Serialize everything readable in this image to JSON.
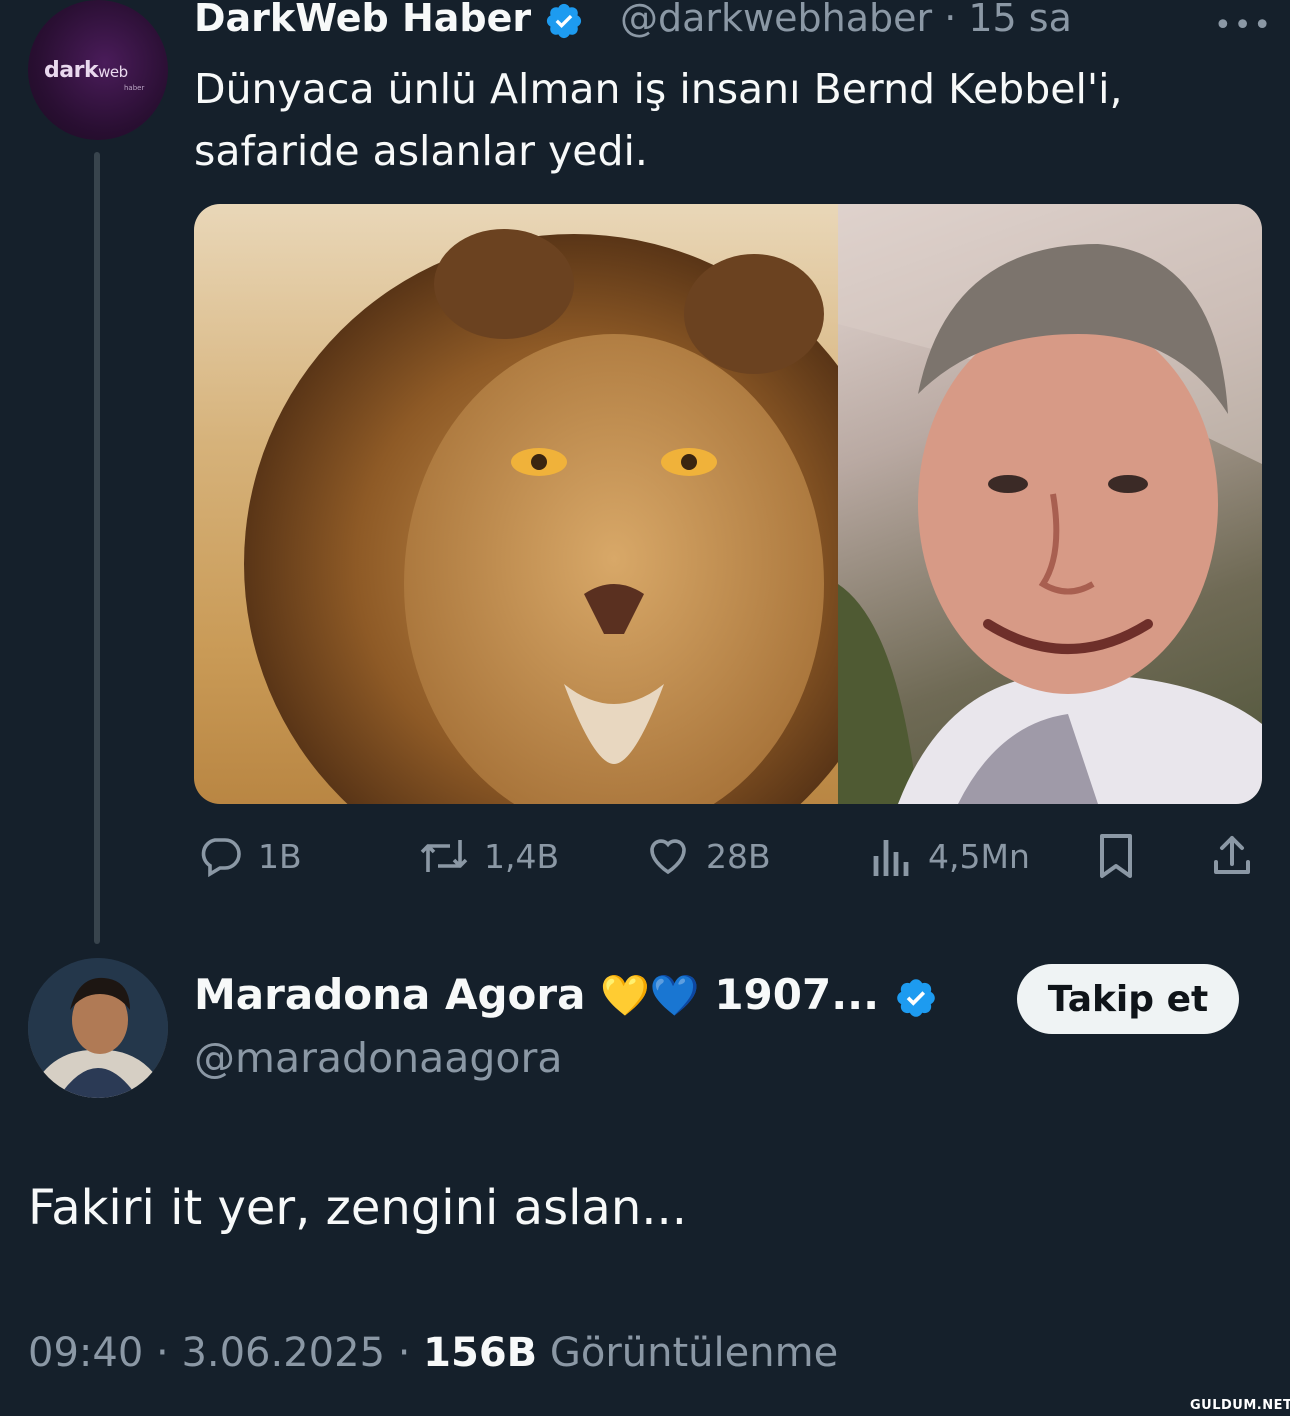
{
  "tweet": {
    "author_name": "DarkWeb Haber",
    "author_handle": "@darkwebhaber",
    "time_ago": "15 sa",
    "avatar_logo_main": "dark",
    "avatar_logo_sub": "web",
    "avatar_logo_tag": "haber",
    "text_line1": "Dünyaca ünlü Alman iş insanı Bernd Kebbel'i,",
    "text_line2": "safaride aslanlar yedi.",
    "actions": {
      "replies": "1B",
      "retweets": "1,4B",
      "likes": "28B",
      "views": "4,5Mn"
    }
  },
  "reply": {
    "author_name": "Maradona Agora",
    "emoji": "💛💙",
    "name_suffix": "1907...",
    "author_handle": "@maradonaagora",
    "follow_label": "Takip et",
    "text": "Fakiri it yer, zengini aslan...",
    "time": "09:40",
    "date": "3.06.2025",
    "views_count": "156B",
    "views_label": "Görüntülenme"
  },
  "watermark": "GULDUM.NET",
  "colors": {
    "background": "#15202b",
    "verified": "#1d9bf0",
    "muted": "#8b98a5"
  }
}
